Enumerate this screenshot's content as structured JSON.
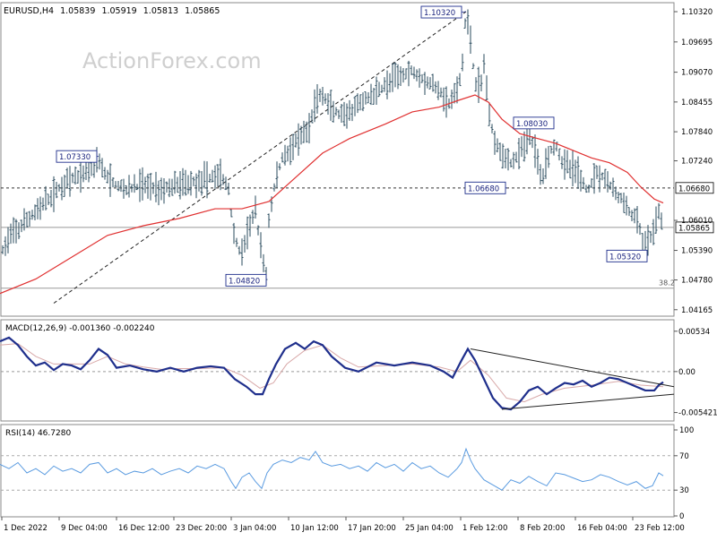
{
  "header": {
    "symbol": "EURUSD,H4",
    "open": "1.05839",
    "high": "1.05919",
    "low": "1.05813",
    "close": "1.05865"
  },
  "watermark": "ActionForex.com",
  "colors": {
    "price_bars": "#2a4b5e",
    "ema": "#e03030",
    "macd_line": "#1f2f8c",
    "macd_signal": "#d8a8a8",
    "rsi_line": "#5a9be0",
    "label_border": "#1f2f8c",
    "current_price_box": "#ffffff"
  },
  "chart_data": [
    {
      "type": "line",
      "subtype": "price-bars-with-moving-average",
      "title": "EURUSD,H4",
      "x_tick_labels": [
        "1 Dec 2022",
        "9 Dec 04:00",
        "16 Dec 12:00",
        "23 Dec 20:00",
        "3 Jan 04:00",
        "10 Jan 12:00",
        "17 Jan 20:00",
        "25 Jan 04:00",
        "1 Feb 12:00",
        "8 Feb 20:00",
        "16 Feb 04:00",
        "23 Feb 12:00"
      ],
      "y_tick_labels": [
        "1.10320",
        "1.09695",
        "1.09070",
        "1.08455",
        "1.07840",
        "1.07240",
        "1.06010",
        "1.05390",
        "1.04780",
        "1.04165"
      ],
      "ylim": [
        1.0405,
        1.1045
      ],
      "price_path": [
        [
          0,
          1.0525
        ],
        [
          8,
          1.056
        ],
        [
          22,
          1.0585
        ],
        [
          40,
          1.062
        ],
        [
          55,
          1.0645
        ],
        [
          70,
          1.0675
        ],
        [
          85,
          1.069
        ],
        [
          95,
          1.07
        ],
        [
          105,
          1.072
        ],
        [
          110,
          1.0733
        ],
        [
          115,
          1.07
        ],
        [
          125,
          1.068
        ],
        [
          140,
          1.0665
        ],
        [
          160,
          1.0675
        ],
        [
          180,
          1.0665
        ],
        [
          200,
          1.0675
        ],
        [
          215,
          1.068
        ],
        [
          230,
          1.0685
        ],
        [
          245,
          1.0698
        ],
        [
          255,
          1.0665
        ],
        [
          262,
          1.056
        ],
        [
          270,
          1.053
        ],
        [
          278,
          1.059
        ],
        [
          285,
          1.062
        ],
        [
          292,
          1.053
        ],
        [
          297,
          1.049
        ],
        [
          300,
          1.06
        ],
        [
          307,
          1.068
        ],
        [
          315,
          1.073
        ],
        [
          330,
          1.076
        ],
        [
          345,
          1.079
        ],
        [
          352,
          1.085
        ],
        [
          360,
          1.086
        ],
        [
          370,
          1.083
        ],
        [
          385,
          1.081
        ],
        [
          400,
          1.084
        ],
        [
          415,
          1.086
        ],
        [
          430,
          1.088
        ],
        [
          445,
          1.09
        ],
        [
          460,
          1.091
        ],
        [
          475,
          1.089
        ],
        [
          490,
          1.087
        ],
        [
          500,
          1.084
        ],
        [
          508,
          1.086
        ],
        [
          515,
          1.09
        ],
        [
          520,
          1.1032
        ],
        [
          525,
          1.098
        ],
        [
          530,
          1.088
        ],
        [
          537,
          1.088
        ],
        [
          541,
          1.094
        ],
        [
          545,
          1.082
        ],
        [
          552,
          1.077
        ],
        [
          560,
          1.074
        ],
        [
          570,
          1.072
        ],
        [
          580,
          1.074
        ],
        [
          592,
          1.078
        ],
        [
          600,
          1.072
        ],
        [
          605,
          1.069
        ],
        [
          612,
          1.074
        ],
        [
          620,
          1.076
        ],
        [
          628,
          1.072
        ],
        [
          636,
          1.071
        ],
        [
          645,
          1.07
        ],
        [
          655,
          1.066
        ],
        [
          665,
          1.07
        ],
        [
          675,
          1.069
        ],
        [
          685,
          1.066
        ],
        [
          695,
          1.064
        ],
        [
          705,
          1.061
        ],
        [
          712,
          1.06
        ],
        [
          718,
          1.0545
        ],
        [
          725,
          1.056
        ],
        [
          732,
          1.06
        ],
        [
          736,
          1.062
        ],
        [
          740,
          1.0587
        ]
      ],
      "moving_average": [
        [
          0,
          1.045
        ],
        [
          40,
          1.048
        ],
        [
          80,
          1.0525
        ],
        [
          120,
          1.057
        ],
        [
          160,
          1.059
        ],
        [
          200,
          1.0605
        ],
        [
          240,
          1.0625
        ],
        [
          270,
          1.0625
        ],
        [
          300,
          1.064
        ],
        [
          330,
          1.069
        ],
        [
          360,
          1.074
        ],
        [
          390,
          1.077
        ],
        [
          430,
          1.08
        ],
        [
          460,
          1.0825
        ],
        [
          490,
          1.0835
        ],
        [
          510,
          1.0848
        ],
        [
          530,
          1.086
        ],
        [
          545,
          1.0845
        ],
        [
          560,
          1.081
        ],
        [
          580,
          1.078
        ],
        [
          600,
          1.077
        ],
        [
          620,
          1.076
        ],
        [
          640,
          1.0745
        ],
        [
          660,
          1.073
        ],
        [
          680,
          1.072
        ],
        [
          700,
          1.07
        ],
        [
          715,
          1.067
        ],
        [
          730,
          1.0645
        ],
        [
          740,
          1.0637
        ]
      ],
      "price_labels": [
        {
          "text": "1.10320",
          "x": 520,
          "y": 1.1032
        },
        {
          "text": "1.07330",
          "x": 110,
          "y": 1.0733
        },
        {
          "text": "1.06680",
          "x": 566,
          "y": 1.0668
        },
        {
          "text": "1.04820",
          "x": 297,
          "y": 1.0482
        },
        {
          "text": "1.08030",
          "x": 610,
          "y": 1.0803
        },
        {
          "text": "1.05320",
          "x": 716,
          "y": 1.0532
        }
      ],
      "horizontal_levels": [
        {
          "value": 1.0668,
          "label": "1.06680",
          "style": "dashed"
        },
        {
          "value": 1.05865,
          "label": "1.05865",
          "style": "solid"
        },
        {
          "value": 1.0461,
          "label": "38.2",
          "style": "solid"
        }
      ],
      "trendline": {
        "from": [
          60,
          1.043
        ],
        "to": [
          520,
          1.1032
        ],
        "style": "dashed"
      }
    },
    {
      "type": "line",
      "title": "MACD(12,26,9) -0.001360 -0.002240",
      "y_tick_labels": [
        "0.00534",
        "0.00",
        "-0.005421"
      ],
      "ylim": [
        -0.0063,
        0.0065
      ],
      "macd_line": [
        [
          0,
          0.004
        ],
        [
          10,
          0.0045
        ],
        [
          20,
          0.0035
        ],
        [
          30,
          0.002
        ],
        [
          40,
          0.0008
        ],
        [
          50,
          0.0012
        ],
        [
          60,
          0.0002
        ],
        [
          70,
          0.001
        ],
        [
          80,
          0.0008
        ],
        [
          90,
          0.0003
        ],
        [
          100,
          0.0015
        ],
        [
          110,
          0.003
        ],
        [
          120,
          0.0022
        ],
        [
          130,
          0.0005
        ],
        [
          145,
          0.0008
        ],
        [
          160,
          0.0003
        ],
        [
          175,
          0.0
        ],
        [
          190,
          0.0005
        ],
        [
          205,
          0.0
        ],
        [
          220,
          0.0005
        ],
        [
          235,
          0.0007
        ],
        [
          250,
          0.0005
        ],
        [
          262,
          -0.001
        ],
        [
          275,
          -0.002
        ],
        [
          285,
          -0.003
        ],
        [
          293,
          -0.003
        ],
        [
          300,
          -0.001
        ],
        [
          308,
          0.001
        ],
        [
          318,
          0.003
        ],
        [
          330,
          0.0038
        ],
        [
          340,
          0.003
        ],
        [
          350,
          0.004
        ],
        [
          360,
          0.0035
        ],
        [
          370,
          0.002
        ],
        [
          385,
          0.0005
        ],
        [
          400,
          0.0
        ],
        [
          420,
          0.0012
        ],
        [
          440,
          0.0008
        ],
        [
          460,
          0.0012
        ],
        [
          480,
          0.0008
        ],
        [
          495,
          0.0
        ],
        [
          505,
          -0.0008
        ],
        [
          515,
          0.0015
        ],
        [
          522,
          0.003
        ],
        [
          530,
          0.0015
        ],
        [
          540,
          -0.001
        ],
        [
          550,
          -0.0035
        ],
        [
          560,
          -0.0048
        ],
        [
          570,
          -0.005
        ],
        [
          580,
          -0.004
        ],
        [
          590,
          -0.0025
        ],
        [
          600,
          -0.002
        ],
        [
          610,
          -0.003
        ],
        [
          620,
          -0.0022
        ],
        [
          630,
          -0.0015
        ],
        [
          640,
          -0.0017
        ],
        [
          650,
          -0.0012
        ],
        [
          660,
          -0.002
        ],
        [
          670,
          -0.0015
        ],
        [
          680,
          -0.0008
        ],
        [
          690,
          -0.001
        ],
        [
          700,
          -0.0015
        ],
        [
          710,
          -0.002
        ],
        [
          720,
          -0.0025
        ],
        [
          730,
          -0.0025
        ],
        [
          735,
          -0.0018
        ],
        [
          740,
          -0.0014
        ]
      ],
      "signal_line": [
        [
          0,
          0.0035
        ],
        [
          20,
          0.0037
        ],
        [
          40,
          0.002
        ],
        [
          60,
          0.001
        ],
        [
          80,
          0.001
        ],
        [
          100,
          0.001
        ],
        [
          120,
          0.002
        ],
        [
          140,
          0.001
        ],
        [
          160,
          0.0006
        ],
        [
          180,
          0.0003
        ],
        [
          200,
          0.0004
        ],
        [
          220,
          0.0004
        ],
        [
          250,
          0.0005
        ],
        [
          270,
          -0.0005
        ],
        [
          290,
          -0.0022
        ],
        [
          305,
          -0.0015
        ],
        [
          320,
          0.001
        ],
        [
          340,
          0.0028
        ],
        [
          360,
          0.0035
        ],
        [
          380,
          0.0018
        ],
        [
          400,
          0.0006
        ],
        [
          430,
          0.0008
        ],
        [
          460,
          0.001
        ],
        [
          490,
          0.0006
        ],
        [
          510,
          0.0
        ],
        [
          525,
          0.0015
        ],
        [
          545,
          -0.0005
        ],
        [
          565,
          -0.0035
        ],
        [
          585,
          -0.004
        ],
        [
          605,
          -0.003
        ],
        [
          630,
          -0.0022
        ],
        [
          660,
          -0.0018
        ],
        [
          690,
          -0.0013
        ],
        [
          715,
          -0.0018
        ],
        [
          740,
          -0.002
        ]
      ],
      "trendlines": [
        {
          "from": [
            525,
            0.003
          ],
          "to": [
            752,
            -0.002
          ]
        },
        {
          "from": [
            560,
            -0.005
          ],
          "to": [
            752,
            -0.003
          ]
        }
      ]
    },
    {
      "type": "line",
      "title": "RSI(14) 46.7280",
      "y_tick_labels": [
        "100",
        "70",
        "30",
        "0"
      ],
      "ylim": [
        0,
        100
      ],
      "levels": [
        70,
        30
      ],
      "rsi_line": [
        [
          0,
          60
        ],
        [
          10,
          55
        ],
        [
          20,
          62
        ],
        [
          30,
          50
        ],
        [
          40,
          55
        ],
        [
          50,
          48
        ],
        [
          60,
          58
        ],
        [
          70,
          52
        ],
        [
          80,
          55
        ],
        [
          90,
          50
        ],
        [
          100,
          60
        ],
        [
          110,
          62
        ],
        [
          120,
          50
        ],
        [
          130,
          55
        ],
        [
          140,
          48
        ],
        [
          150,
          52
        ],
        [
          160,
          50
        ],
        [
          170,
          55
        ],
        [
          180,
          48
        ],
        [
          190,
          52
        ],
        [
          200,
          55
        ],
        [
          210,
          50
        ],
        [
          220,
          58
        ],
        [
          230,
          55
        ],
        [
          240,
          60
        ],
        [
          250,
          55
        ],
        [
          258,
          40
        ],
        [
          263,
          32
        ],
        [
          270,
          45
        ],
        [
          278,
          50
        ],
        [
          285,
          40
        ],
        [
          292,
          32
        ],
        [
          298,
          50
        ],
        [
          305,
          60
        ],
        [
          315,
          65
        ],
        [
          325,
          62
        ],
        [
          335,
          68
        ],
        [
          345,
          65
        ],
        [
          352,
          75
        ],
        [
          360,
          62
        ],
        [
          370,
          58
        ],
        [
          380,
          60
        ],
        [
          390,
          55
        ],
        [
          400,
          58
        ],
        [
          410,
          52
        ],
        [
          420,
          62
        ],
        [
          430,
          56
        ],
        [
          440,
          60
        ],
        [
          450,
          52
        ],
        [
          460,
          62
        ],
        [
          470,
          55
        ],
        [
          480,
          58
        ],
        [
          490,
          50
        ],
        [
          500,
          45
        ],
        [
          510,
          55
        ],
        [
          515,
          62
        ],
        [
          520,
          78
        ],
        [
          525,
          65
        ],
        [
          530,
          55
        ],
        [
          540,
          42
        ],
        [
          550,
          36
        ],
        [
          560,
          30
        ],
        [
          570,
          42
        ],
        [
          580,
          38
        ],
        [
          590,
          46
        ],
        [
          600,
          40
        ],
        [
          610,
          35
        ],
        [
          620,
          50
        ],
        [
          630,
          48
        ],
        [
          640,
          44
        ],
        [
          650,
          40
        ],
        [
          660,
          42
        ],
        [
          670,
          48
        ],
        [
          680,
          45
        ],
        [
          690,
          40
        ],
        [
          700,
          36
        ],
        [
          710,
          40
        ],
        [
          720,
          32
        ],
        [
          728,
          35
        ],
        [
          735,
          50
        ],
        [
          740,
          46.7
        ]
      ]
    }
  ]
}
